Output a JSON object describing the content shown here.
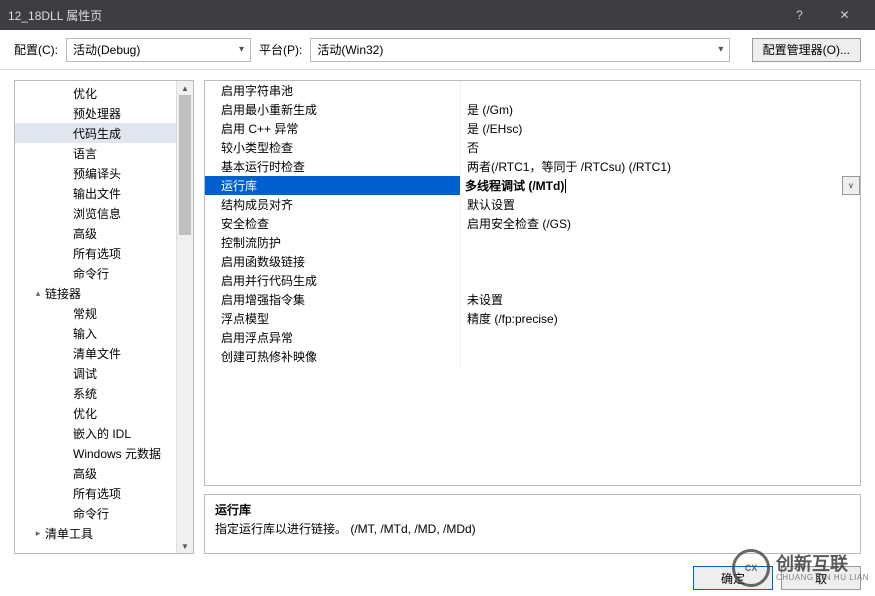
{
  "window": {
    "title": "12_18DLL 属性页",
    "help": "?",
    "close": "✕"
  },
  "toolbar": {
    "config_label": "配置(C):",
    "config_value": "活动(Debug)",
    "platform_label": "平台(P):",
    "platform_value": "活动(Win32)",
    "manager_btn": "配置管理器(O)..."
  },
  "tree": [
    {
      "label": "优化",
      "level": 2
    },
    {
      "label": "预处理器",
      "level": 2
    },
    {
      "label": "代码生成",
      "level": 2,
      "selected": true
    },
    {
      "label": "语言",
      "level": 2
    },
    {
      "label": "预编译头",
      "level": 2
    },
    {
      "label": "输出文件",
      "level": 2
    },
    {
      "label": "浏览信息",
      "level": 2
    },
    {
      "label": "高级",
      "level": 2
    },
    {
      "label": "所有选项",
      "level": 2
    },
    {
      "label": "命令行",
      "level": 2
    },
    {
      "label": "链接器",
      "level": 1,
      "caret": "▴"
    },
    {
      "label": "常规",
      "level": 2
    },
    {
      "label": "输入",
      "level": 2
    },
    {
      "label": "清单文件",
      "level": 2
    },
    {
      "label": "调试",
      "level": 2
    },
    {
      "label": "系统",
      "level": 2
    },
    {
      "label": "优化",
      "level": 2
    },
    {
      "label": "嵌入的 IDL",
      "level": 2
    },
    {
      "label": "Windows 元数据",
      "level": 2
    },
    {
      "label": "高级",
      "level": 2
    },
    {
      "label": "所有选项",
      "level": 2
    },
    {
      "label": "命令行",
      "level": 2
    },
    {
      "label": "清单工具",
      "level": 1,
      "caret": "▸"
    }
  ],
  "grid": [
    {
      "name": "启用字符串池",
      "value": ""
    },
    {
      "name": "启用最小重新生成",
      "value": "是 (/Gm)"
    },
    {
      "name": "启用 C++ 异常",
      "value": "是 (/EHsc)"
    },
    {
      "name": "较小类型检查",
      "value": "否"
    },
    {
      "name": "基本运行时检查",
      "value": "两者(/RTC1，等同于 /RTCsu) (/RTC1)"
    },
    {
      "name": "运行库",
      "value": "多线程调试 (/MTd)",
      "selected": true
    },
    {
      "name": "结构成员对齐",
      "value": "默认设置"
    },
    {
      "name": "安全检查",
      "value": "启用安全检查 (/GS)"
    },
    {
      "name": "控制流防护",
      "value": ""
    },
    {
      "name": "启用函数级链接",
      "value": ""
    },
    {
      "name": "启用并行代码生成",
      "value": ""
    },
    {
      "name": "启用增强指令集",
      "value": "未设置"
    },
    {
      "name": "浮点模型",
      "value": "精度 (/fp:precise)"
    },
    {
      "name": "启用浮点异常",
      "value": ""
    },
    {
      "name": "创建可热修补映像",
      "value": ""
    }
  ],
  "desc": {
    "title": "运行库",
    "text": "指定运行库以进行链接。    (/MT, /MTd, /MD, /MDd)"
  },
  "footer": {
    "ok": "确定",
    "cancel": "取"
  },
  "watermark": {
    "main": "创新互联",
    "sub": "CHUANG XIN HU LIAN",
    "logo": "CX"
  }
}
